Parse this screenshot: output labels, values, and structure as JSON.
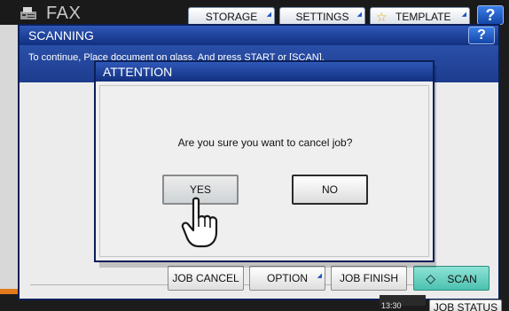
{
  "topbar": {
    "title": "FAX",
    "tabs": [
      {
        "label": "STORAGE"
      },
      {
        "label": "SETTINGS"
      },
      {
        "label": "TEMPLATE"
      }
    ],
    "help_label": "?"
  },
  "scanning": {
    "title": "SCANNING",
    "help_label": "?",
    "message": "To continue, Place document on glass. And press START or [SCAN].",
    "actions": {
      "job_cancel": "JOB CANCEL",
      "option": "OPTION",
      "job_finish": "JOB FINISH",
      "scan": "SCAN"
    }
  },
  "status": {
    "time": "13:30",
    "job_status": "JOB STATUS"
  },
  "attention": {
    "title": "ATTENTION",
    "question": "Are you sure you want to cancel job?",
    "yes_label": "YES",
    "no_label": "NO"
  },
  "icons": [
    "fax-icon",
    "star-icon",
    "scan-diamond-icon",
    "hand-pointer-icon"
  ],
  "colors": {
    "title_bar": "#12307f",
    "message_band": "#1d3c8e",
    "scan_button": "#4cc1b0",
    "accent_orange": "#e37a1c"
  }
}
